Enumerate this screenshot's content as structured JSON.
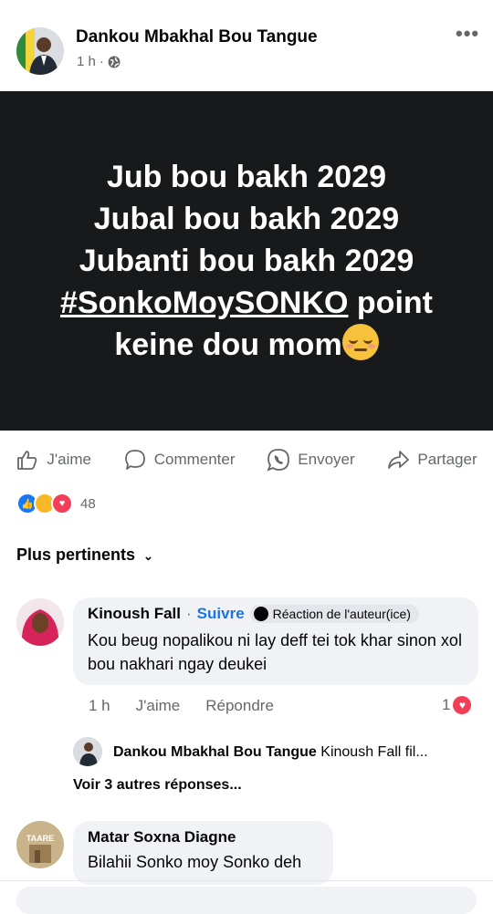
{
  "post": {
    "author": "Dankou Mbakhal Bou Tangue",
    "time": "1 h",
    "privacy_icon": "globe-icon",
    "more_icon": "more-dots-icon",
    "lines": [
      "Jub bou bakh 2029",
      "Jubal bou bakh 2029",
      "Jubanti bou bakh 2029"
    ],
    "hashtag": "#SonkoMoySONKO",
    "after_hashtag": " point",
    "last_line": "keine dou mom",
    "bg_color": "#18191a"
  },
  "actions": {
    "like": "J'aime",
    "comment": "Commenter",
    "send": "Envoyer",
    "share": "Partager"
  },
  "reactions": {
    "count": "48",
    "types": [
      "like",
      "haha",
      "love"
    ]
  },
  "sort_label": "Plus pertinents",
  "comments": [
    {
      "name": "Kinoush Fall",
      "follow": "Suivre",
      "badge": "Réaction de l'auteur(ice)",
      "text": "Kou beug nopalikou ni lay deff tei tok khar sinon xol bou nakhari ngay deukei",
      "time": "1 h",
      "like": "J'aime",
      "reply": "Répondre",
      "reaction_count": "1"
    },
    {
      "name": "Matar Soxna Diagne",
      "text": "Bilahii Sonko moy Sonko deh"
    }
  ],
  "reply": {
    "name": "Dankou Mbakhal Bou Tangue",
    "preview": "Kinoush Fall fil..."
  },
  "more_replies": "Voir 3 autres réponses...",
  "avatar_label": "TAARE"
}
